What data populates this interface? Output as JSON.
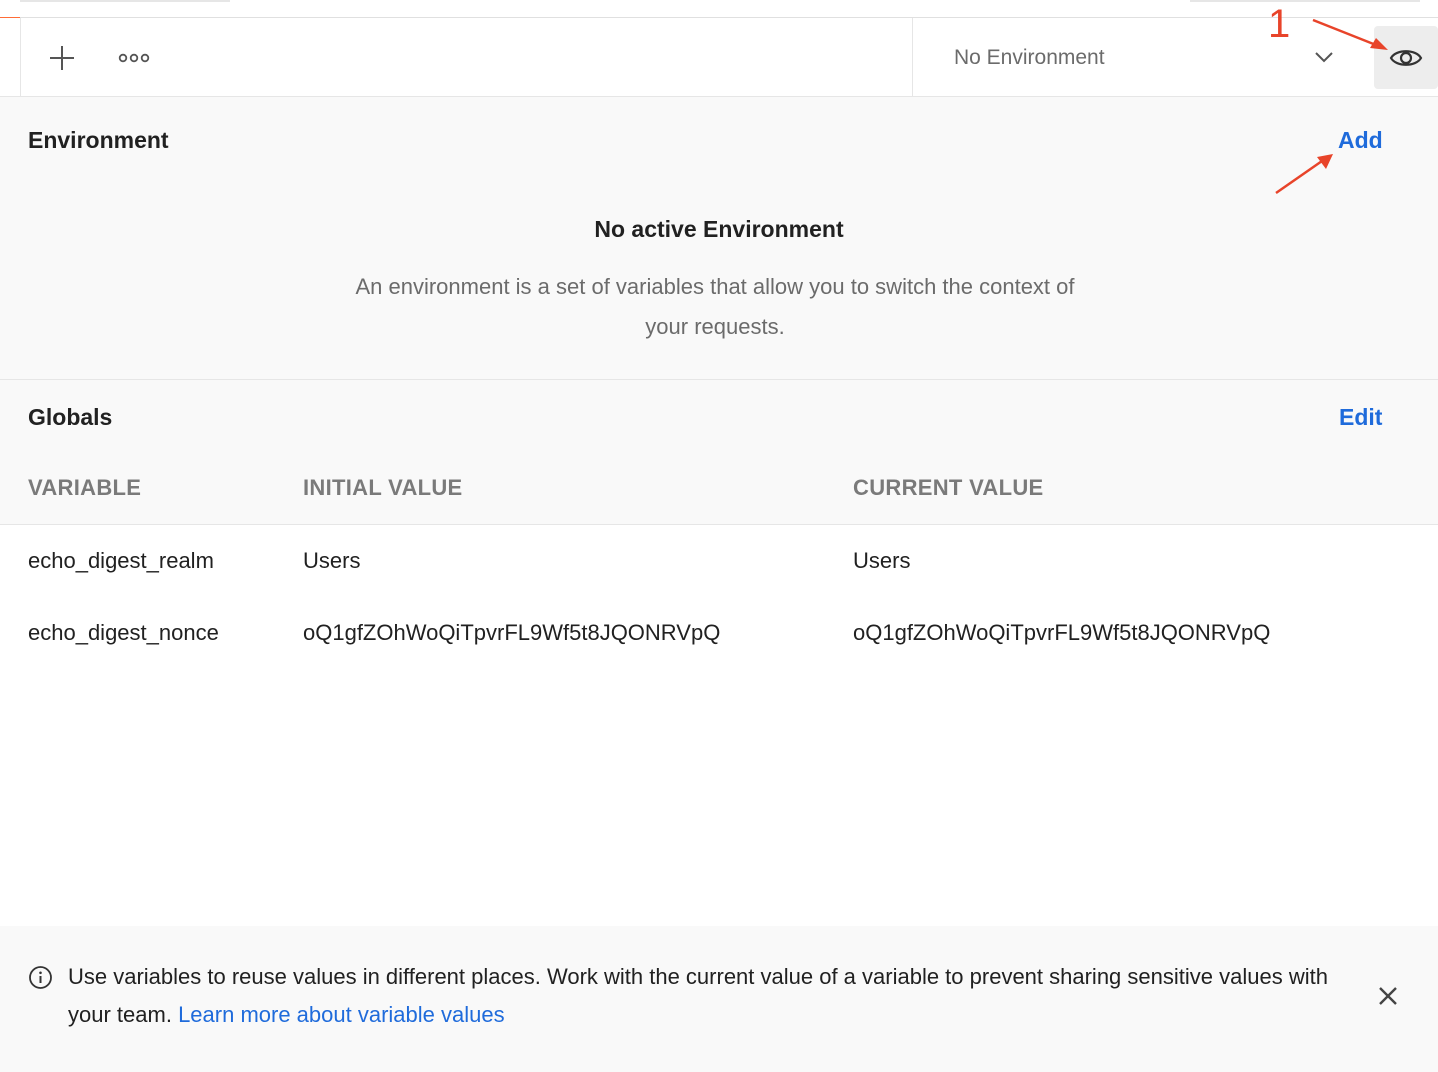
{
  "toolbar": {
    "new_tab_icon": "plus-icon",
    "more_icon": "more-horizontal-icon",
    "environment_selector": {
      "value": "No Environment",
      "icon": "chevron-down-icon"
    },
    "quick_look_icon": "eye-icon"
  },
  "annotation": {
    "step_number": "1"
  },
  "environment": {
    "title": "Environment",
    "add_label": "Add",
    "empty_title": "No active Environment",
    "empty_description": "An environment is a set of variables that allow you to switch the context of your requests."
  },
  "globals": {
    "title": "Globals",
    "edit_label": "Edit",
    "columns": [
      "VARIABLE",
      "INITIAL VALUE",
      "CURRENT VALUE"
    ],
    "rows": [
      {
        "variable": "echo_digest_realm",
        "initial": "Users",
        "current": "Users"
      },
      {
        "variable": "echo_digest_nonce",
        "initial": "oQ1gfZOhWoQiTpvrFL9Wf5t8JQONRVpQ",
        "current": "oQ1gfZOhWoQiTpvrFL9Wf5t8JQONRVpQ"
      }
    ]
  },
  "info": {
    "icon": "info-icon",
    "message": "Use variables to reuse values in different places. Work with the current value of a variable to prevent sharing sensitive values with your team.",
    "link_label": "Learn more about variable values",
    "close_icon": "close-icon"
  },
  "colors": {
    "accent_blue": "#1f6bdb",
    "brand_orange": "#ff6c37",
    "annotation_red": "#e8442a"
  }
}
